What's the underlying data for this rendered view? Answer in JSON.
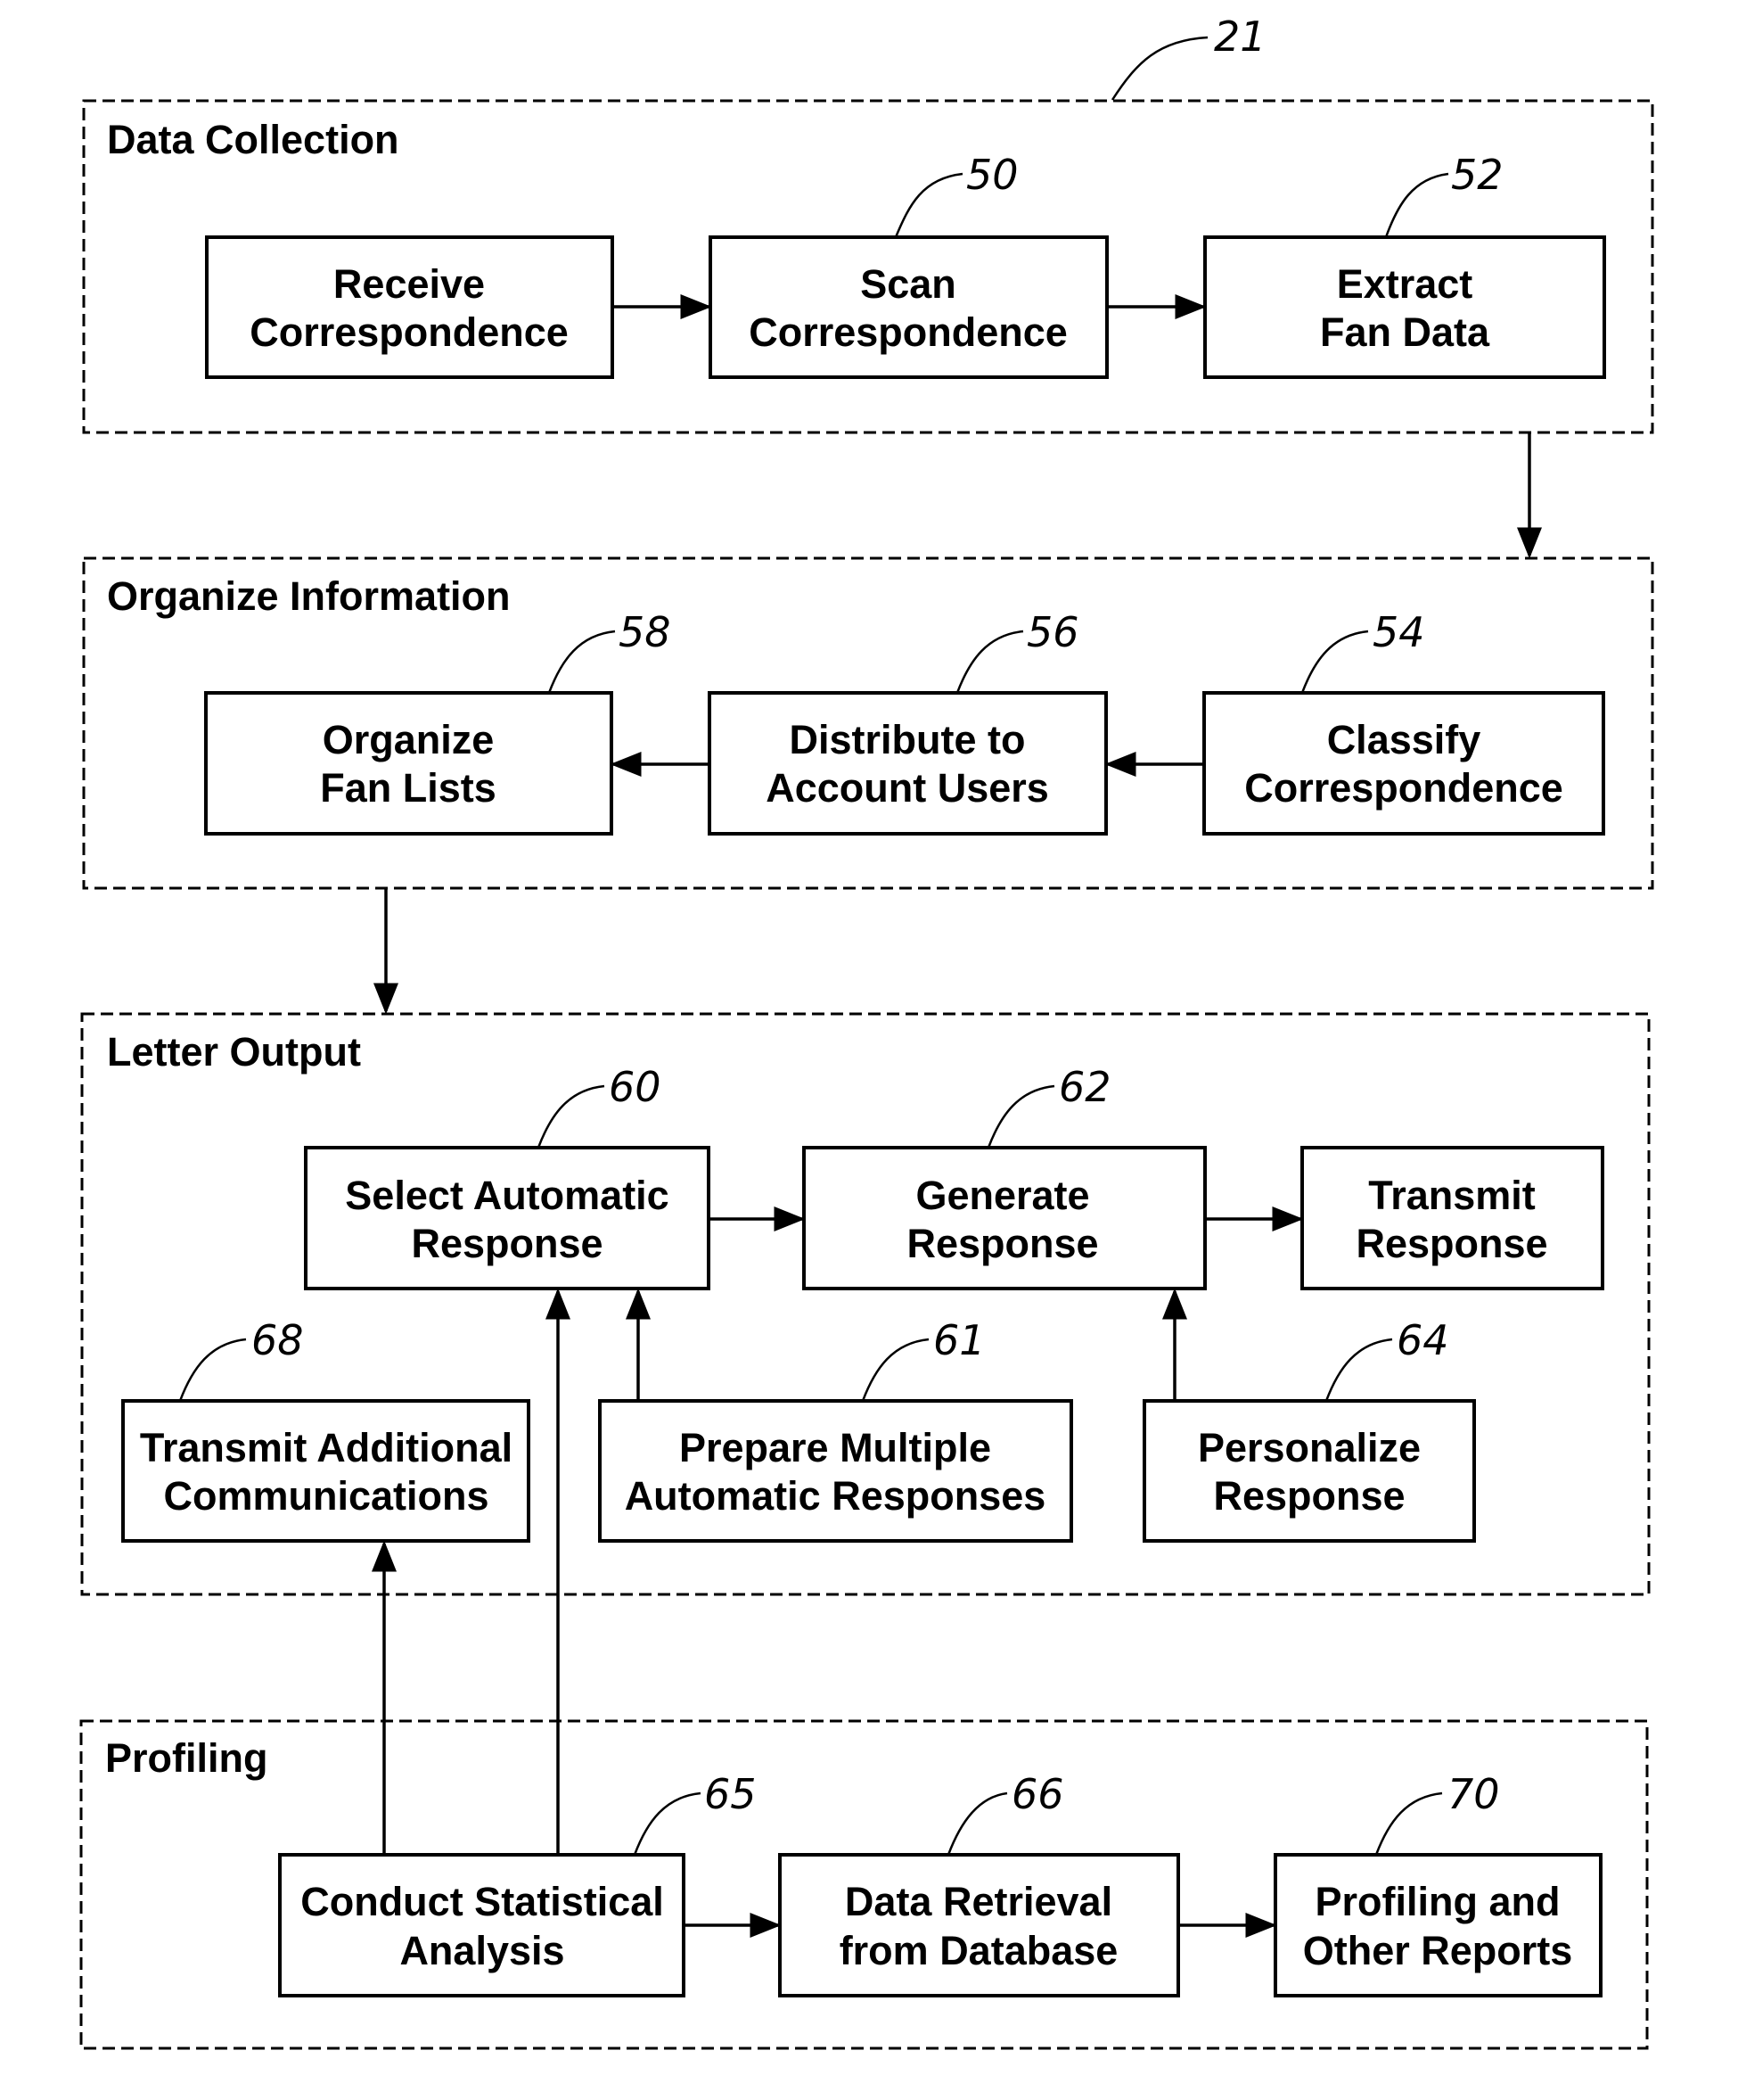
{
  "figure_ref": "21",
  "groups": [
    {
      "id": "data-collection",
      "title": "Data Collection",
      "boxes": [
        {
          "id": "receive",
          "lines": [
            "Receive",
            "Correspondence"
          ],
          "ref": ""
        },
        {
          "id": "scan",
          "lines": [
            "Scan",
            "Correspondence"
          ],
          "ref": "50"
        },
        {
          "id": "extract",
          "lines": [
            "Extract",
            "Fan Data"
          ],
          "ref": "52"
        }
      ]
    },
    {
      "id": "organize-information",
      "title": "Organize Information",
      "boxes": [
        {
          "id": "organize",
          "lines": [
            "Organize",
            "Fan Lists"
          ],
          "ref": "58"
        },
        {
          "id": "distribute",
          "lines": [
            "Distribute to",
            "Account Users"
          ],
          "ref": "56"
        },
        {
          "id": "classify",
          "lines": [
            "Classify",
            "Correspondence"
          ],
          "ref": "54"
        }
      ]
    },
    {
      "id": "letter-output",
      "title": "Letter Output",
      "boxes": [
        {
          "id": "select",
          "lines": [
            "Select Automatic",
            "Response"
          ],
          "ref": "60"
        },
        {
          "id": "generate",
          "lines": [
            "Generate",
            "Response"
          ],
          "ref": "62"
        },
        {
          "id": "transmit",
          "lines": [
            "Transmit",
            "Response"
          ],
          "ref": ""
        },
        {
          "id": "transmit-additional",
          "lines": [
            "Transmit Additional",
            "Communications"
          ],
          "ref": "68"
        },
        {
          "id": "prepare",
          "lines": [
            "Prepare Multiple",
            "Automatic Responses"
          ],
          "ref": "61"
        },
        {
          "id": "personalize",
          "lines": [
            "Personalize",
            "Response"
          ],
          "ref": "64"
        }
      ]
    },
    {
      "id": "profiling",
      "title": "Profiling",
      "boxes": [
        {
          "id": "statistical",
          "lines": [
            "Conduct Statistical",
            "Analysis"
          ],
          "ref": "65"
        },
        {
          "id": "retrieval",
          "lines": [
            "Data Retrieval",
            "from Database"
          ],
          "ref": "66"
        },
        {
          "id": "reports",
          "lines": [
            "Profiling and",
            "Other Reports"
          ],
          "ref": "70"
        }
      ]
    }
  ],
  "connections": [
    {
      "from": "receive",
      "to": "scan"
    },
    {
      "from": "scan",
      "to": "extract"
    },
    {
      "from": "data-collection",
      "to": "organize-information"
    },
    {
      "from": "classify",
      "to": "distribute"
    },
    {
      "from": "distribute",
      "to": "organize"
    },
    {
      "from": "organize-information",
      "to": "letter-output"
    },
    {
      "from": "select",
      "to": "generate"
    },
    {
      "from": "generate",
      "to": "transmit"
    },
    {
      "from": "prepare",
      "to": "select"
    },
    {
      "from": "personalize",
      "to": "generate"
    },
    {
      "from": "statistical",
      "to": "select"
    },
    {
      "from": "statistical",
      "to": "transmit-additional"
    },
    {
      "from": "statistical",
      "to": "retrieval"
    },
    {
      "from": "retrieval",
      "to": "reports"
    }
  ]
}
